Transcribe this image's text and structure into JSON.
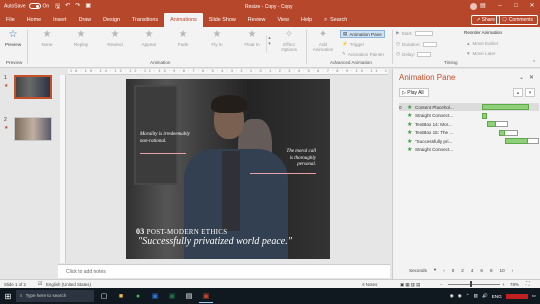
{
  "titlebar": {
    "autosave_label": "AutoSave",
    "autosave_state": "On",
    "doc_title": "Resize - Copy - Copy",
    "icons": [
      "save-icon",
      "undo-icon",
      "redo-icon",
      "present-icon"
    ],
    "window_buttons": [
      "–",
      "□",
      "✕"
    ]
  },
  "tabs": {
    "items": [
      "File",
      "Home",
      "Insert",
      "Draw",
      "Design",
      "Transitions",
      "Animations",
      "Slide Show",
      "Review",
      "View",
      "Help"
    ],
    "active": "Animations",
    "search_label": "Search",
    "share_label": "Share",
    "comments_label": "Comments"
  },
  "ribbon": {
    "preview_label": "Preview",
    "effects": [
      "None",
      "Replay",
      "Rewind",
      "Appear",
      "Fade",
      "Fly In",
      "Float In"
    ],
    "effect_options": [
      "Effect",
      "Options"
    ],
    "add_animation": [
      "Add",
      "Animation"
    ],
    "animation_pane_label": "Animation Pane",
    "trigger_label": "Trigger",
    "animation_painter_label": "Animation Painter",
    "start_label": "Start:",
    "duration_label": "Duration:",
    "delay_label": "Delay:",
    "reorder_label": "Reorder Animation",
    "move_earlier_label": "Move Earlier",
    "move_later_label": "Move Later",
    "group_labels": {
      "preview": "Preview",
      "animation": "Animation",
      "advanced": "Advanced Animation",
      "timing": "Timing"
    }
  },
  "thumbs": [
    {
      "num": "1",
      "selected": true
    },
    {
      "num": "2",
      "selected": false
    }
  ],
  "slide": {
    "quote_left_1": "Morality is irredeemably",
    "quote_left_2": "non-rational.",
    "quote_right_1": "The moral call",
    "quote_right_2": "is thoroughly",
    "quote_right_3": "personal.",
    "heading_num": "03",
    "heading_text": "POST-MODERN ETHICS",
    "tagline": "\"Successfully privatized world peace.\""
  },
  "notes_placeholder": "Click to add notes",
  "anim_pane": {
    "title": "Animation Pane",
    "play_all": "Play All",
    "items": [
      {
        "num": "0",
        "label": "Content Placehol...",
        "bar_start": 0.28,
        "bar_width": 0.62,
        "outline": false
      },
      {
        "num": "",
        "label": "Straight Connect...",
        "bar_start": 0.28,
        "bar_width": 0.06,
        "outline": false
      },
      {
        "num": "",
        "label": "TextBox 14: Mor...",
        "bar_start": 0.34,
        "bar_width": 0.12,
        "outline": true
      },
      {
        "num": "",
        "label": "TextBox 15: The ...",
        "bar_start": 0.5,
        "bar_width": 0.08,
        "outline": true
      },
      {
        "num": "",
        "label": "\"Successfully pri...",
        "bar_start": 0.58,
        "bar_width": 0.3,
        "outline": true
      },
      {
        "num": "",
        "label": "Straight Connect...",
        "bar_start": 0.0,
        "bar_width": 0.0,
        "outline": false
      }
    ],
    "seconds_label": "Seconds",
    "ticks": [
      "0",
      "2",
      "4",
      "6",
      "8",
      "10"
    ]
  },
  "status": {
    "slide_info": "Slide 1 of 2",
    "language": "English (United States)",
    "notes_label": "Notes",
    "zoom": "78%"
  },
  "taskbar": {
    "search_placeholder": "Type here to search",
    "lang": "ENG"
  },
  "colors": {
    "accent": "#b7472a",
    "anim_green": "#8fd17a",
    "pane_title": "#c4502a"
  }
}
